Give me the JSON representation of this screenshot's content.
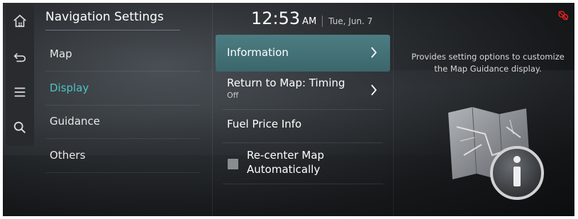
{
  "sidebar": {
    "icons": [
      "home-icon",
      "back-icon",
      "menu-icon",
      "search-icon"
    ]
  },
  "header": {
    "title": "Navigation Settings",
    "time": "12:53",
    "ampm": "AM",
    "date": "Tue, Jun. 7",
    "status_icon": "mute-icon"
  },
  "menu": {
    "items": [
      {
        "label": "Map"
      },
      {
        "label": "Display"
      },
      {
        "label": "Guidance"
      },
      {
        "label": "Others"
      }
    ],
    "active_index": 1
  },
  "options": {
    "items": [
      {
        "label": "Information",
        "selected": true
      },
      {
        "label": "Return to Map: Timing",
        "sub": "Off"
      },
      {
        "label": "Fuel Price Info"
      },
      {
        "label": "Re-center Map Automatically",
        "line1": "Re-center Map",
        "line2": "Automatically",
        "checked": false
      }
    ]
  },
  "detail": {
    "description": "Provides setting options to customize the Map Guidance display.",
    "line1": "Provides setting options to customize",
    "line2": "the Map Guidance display."
  },
  "colors": {
    "accent": "#4fc3c4",
    "selected_bg": "#44737a",
    "status_red": "#e02020"
  }
}
